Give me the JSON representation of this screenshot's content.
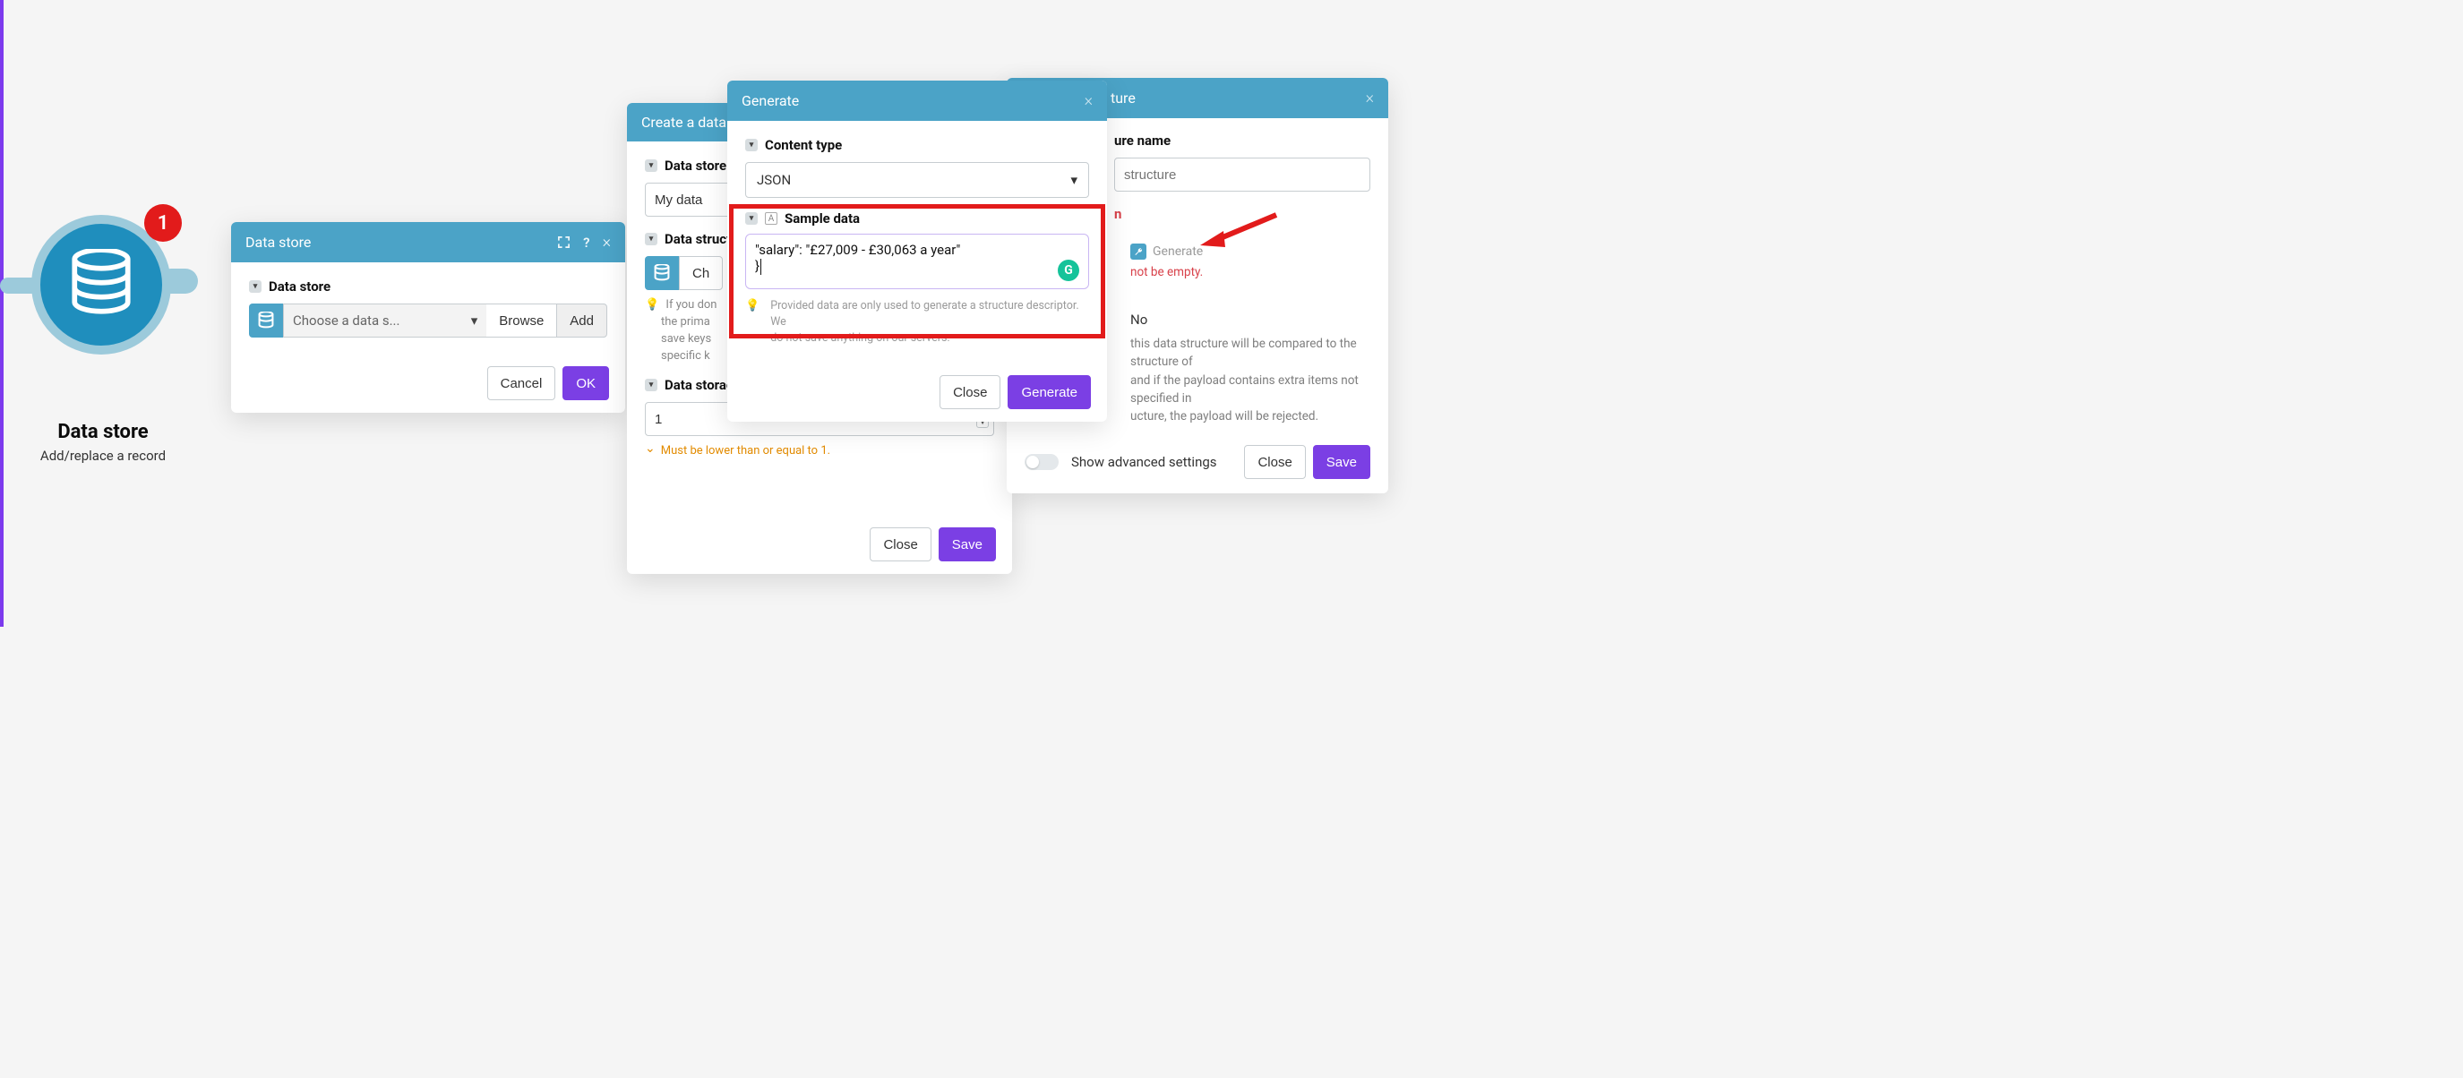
{
  "node": {
    "badge": "1",
    "title": "Data store",
    "subtitle": "Add/replace a record"
  },
  "panel1": {
    "title": "Data store",
    "field_label": "Data store",
    "placeholder": "Choose a data s...",
    "browse": "Browse",
    "add": "Add",
    "cancel": "Cancel",
    "ok": "OK"
  },
  "panel2": {
    "title": "Create a data",
    "name_label": "Data store",
    "name_value": "My data",
    "struct_label": "Data struct",
    "struct_btn": "Ch",
    "info_line1": "If you don",
    "info_line2": "the prima",
    "info_line3": "save keys",
    "info_line4": "specific k",
    "storage_label": "Data storag",
    "storage_value": "1",
    "storage_warn": "Must be lower than or equal to 1.",
    "close": "Close",
    "save": "Save"
  },
  "panel3": {
    "title": "Generate",
    "content_type_label": "Content type",
    "content_type_value": "JSON",
    "sample_label": "Sample data",
    "sample_line1": "\"salary\": \"£27,009 - £30,063 a year\"",
    "sample_line2": "}",
    "hint_line1": "Provided data are only used to generate a structure descriptor. We",
    "hint_line2": "do not save anything on our servers.",
    "close": "Close",
    "generate": "Generate"
  },
  "panel4": {
    "title_fragment": "ture",
    "name_label_fragment": "ure name",
    "name_placeholder": "structure",
    "specification_fragment": "n",
    "generate": "Generate",
    "error": "not be empty.",
    "strict_value": "No",
    "strict_desc_line1": "this data structure will be compared to the structure of",
    "strict_desc_line2": "and if the payload contains extra items not specified in",
    "strict_desc_line3": "ucture, the payload will be rejected.",
    "adv_label": "Show advanced settings",
    "close": "Close",
    "save": "Save"
  }
}
